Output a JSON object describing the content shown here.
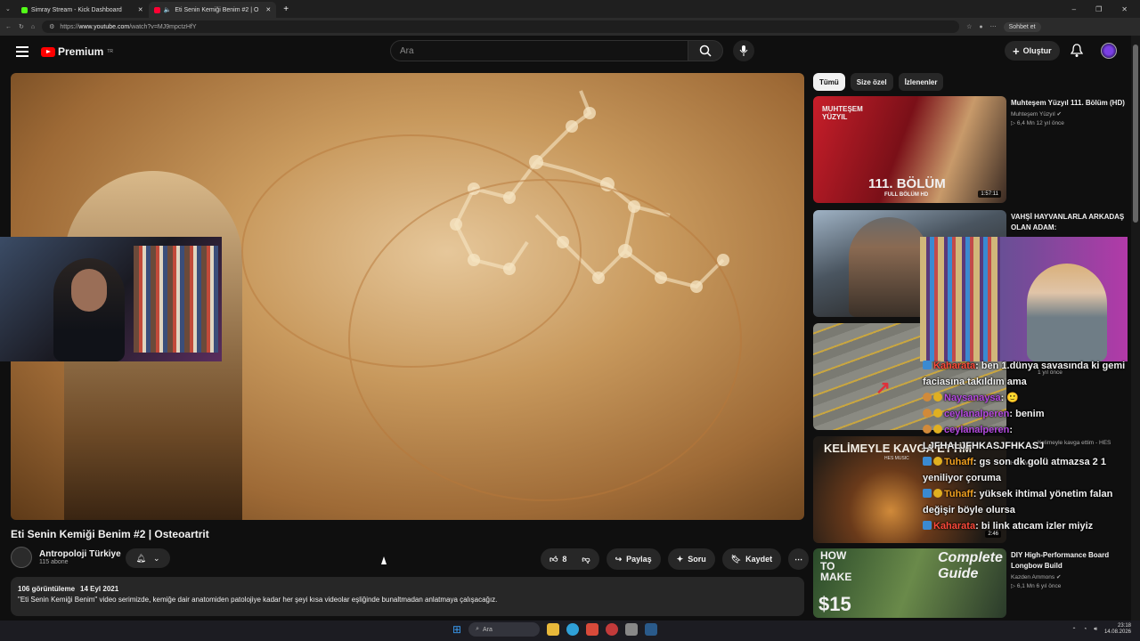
{
  "browser": {
    "tabs": [
      {
        "title": "Simray Stream - Kick Dashboard",
        "active": false,
        "color": "#53fc18"
      },
      {
        "title": "Eti Senin Kemiği Benim #2 | O",
        "active": true,
        "color": "#ff0033"
      }
    ],
    "url_prefix": "https://",
    "url_host": "www.youtube.com",
    "url_path": "/watch?v=MJ9mpctzHfY",
    "chat_button": "Sohbet et"
  },
  "youtube": {
    "logo_text": "Premium",
    "logo_region": "TR",
    "search_placeholder": "Ara",
    "create_label": "Oluştur",
    "video": {
      "title": "Eti Senin Kemiği Benim #2 | Osteoartrit",
      "channel_name": "Antropoloji Türkiye",
      "channel_subs": "115 abone",
      "likes": "8",
      "share_label": "Paylaş",
      "ask_label": "Soru",
      "save_label": "Kaydet",
      "views": "106 görüntüleme",
      "date": "14 Eyl 2021",
      "description": "\"Eti Senin Kemiği Benim\" video serimizde, kemiğe dair anatomiden patolojiye kadar her şeyi kısa videolar eşliğinde bunaltmadan anlatmaya çalışacağız."
    },
    "chips": [
      "Tümü",
      "Size özel",
      "İzlenenler"
    ],
    "recommendations": [
      {
        "title": "Muhteşem Yüzyıl 111. Bölüm (HD)",
        "channel": "Muhteşem Yüzyıl",
        "meta": "6,4 Mn   12 yıl önce",
        "duration": "1:57:11",
        "thumb_text_top": "MUHTEŞEM YÜZYIL",
        "thumb_text_big": "111. BÖLÜM",
        "thumb_text_small": "FULL BÖLÜM HD"
      },
      {
        "title": "VAHŞİ HAYVANLARLA ARKADAŞ OLAN ADAM:",
        "channel": "",
        "meta": "",
        "duration": ""
      },
      {
        "title": "",
        "channel": "",
        "meta": "1 yıl önce",
        "duration": ""
      },
      {
        "title": "Kelimeyle kavga ettim - HES",
        "channel": "HES Music",
        "meta": "",
        "duration": "2:46",
        "thumb_text_big": "KELİMEYLE KAVGA ETTİM",
        "thumb_text_small": "HES MUSIC"
      },
      {
        "title": "DIY High-Performance Board Longbow Build",
        "channel": "Kazden Ammons",
        "meta": "6,1 Mn   6 yıl önce",
        "duration": "",
        "thumb_text_big": "HOW TO MAKE",
        "thumb_text_small": "Complete Guide",
        "thumb_price": "$15"
      }
    ]
  },
  "chat": [
    {
      "user": "Kaharata",
      "user_color": "#ff4a3a",
      "text": ": ben 1.dünya savasında ki gemi faciasına takıldım ama"
    },
    {
      "user": "Naysanaysa",
      "user_color": "#b44ae0",
      "text": ":"
    },
    {
      "user": "ceylanalperen",
      "user_color": "#b44ae0",
      "text": ": benim"
    },
    {
      "user": "ceylanalperen",
      "user_color": "#b44ae0",
      "text": ": LJFHALJFHKASJFHKASJ"
    },
    {
      "user": "Tuhaff",
      "user_color": "#f0a020",
      "text": ": gs son dk golü atmazsa 2 1 yeniliyor çoruma"
    },
    {
      "user": "Tuhaff",
      "user_color": "#f0a020",
      "text": ": yüksek ihtimal yönetim falan değişir böyle olursa"
    },
    {
      "user": "Kaharata",
      "user_color": "#ff4a3a",
      "text": ": bi link atıcam izler miyiz"
    }
  ],
  "taskbar": {
    "search_placeholder": "Ara",
    "time": "23:18",
    "date": "14.08.2026"
  }
}
